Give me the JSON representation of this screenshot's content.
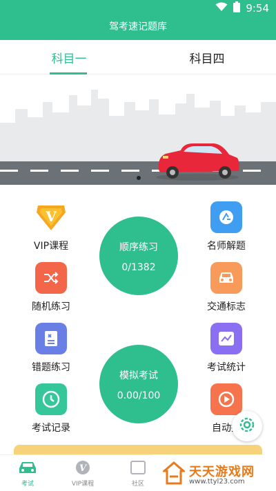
{
  "status": {
    "time": "9:54"
  },
  "header": {
    "title": "驾考速记题库"
  },
  "tabs": [
    {
      "label": "科目一"
    },
    {
      "label": "科目四"
    }
  ],
  "tab_active": "科目一",
  "left_items": [
    {
      "label": "VIP课程",
      "icon": "vip-crown-icon"
    },
    {
      "label": "随机练习",
      "icon": "shuffle-icon"
    },
    {
      "label": "错题练习",
      "icon": "wrong-notes-icon"
    },
    {
      "label": "考试记录",
      "icon": "clock-icon"
    }
  ],
  "right_items": [
    {
      "label": "名师解题",
      "icon": "teacher-icon"
    },
    {
      "label": "交通标志",
      "icon": "car-icon"
    },
    {
      "label": "考试统计",
      "icon": "chart-icon"
    },
    {
      "label": "自动播",
      "icon": "autoplay-icon"
    }
  ],
  "circle1": {
    "title": "顺序练习",
    "value": "0/1382"
  },
  "circle2": {
    "title": "模拟考试",
    "value": "0.00/100"
  },
  "bottom_nav": [
    {
      "label": "考试",
      "icon": "car-icon"
    },
    {
      "label": "VIP课程",
      "icon": "vip-icon"
    },
    {
      "label": "社区",
      "icon": "community-icon"
    }
  ],
  "watermark": {
    "main": "天天游戏网",
    "sub": "www.ttyl23.com"
  },
  "colors": {
    "accent": "#2fbf8e"
  }
}
